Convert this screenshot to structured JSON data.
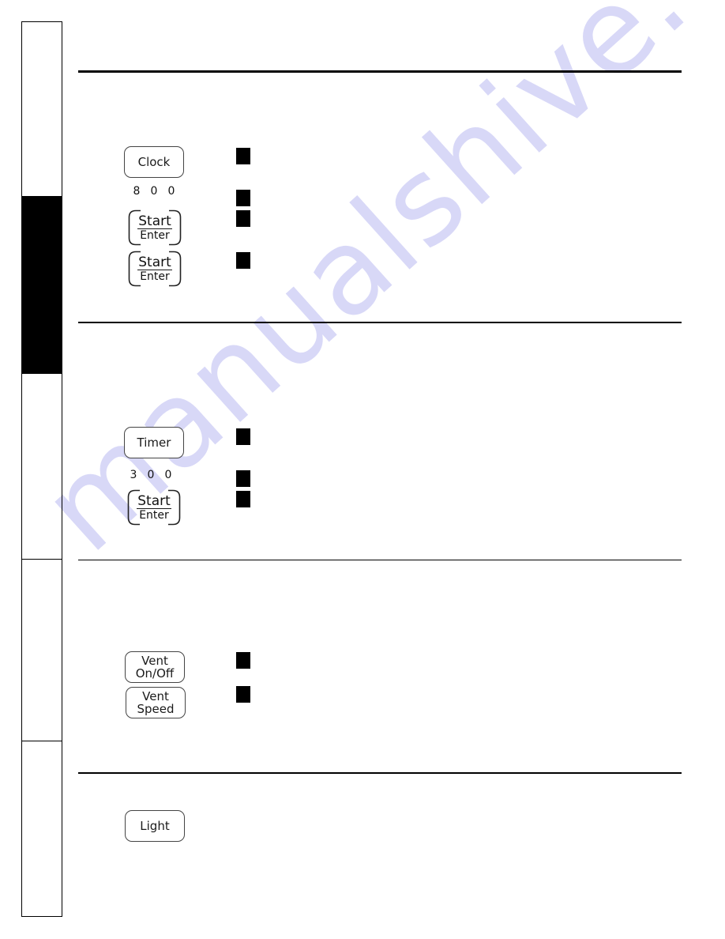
{
  "sidebar": {
    "tabs": [
      {
        "name": "tab-1",
        "active": false
      },
      {
        "name": "tab-2",
        "active": true
      },
      {
        "name": "tab-3",
        "active": false
      },
      {
        "name": "tab-4",
        "active": false
      },
      {
        "name": "tab-5",
        "active": false
      }
    ]
  },
  "sections": {
    "clock": {
      "button_label": "Clock",
      "digits": [
        "8",
        "0",
        "0"
      ],
      "start_label_top": "Start",
      "start_label_bottom": "Enter",
      "steps": 4
    },
    "timer": {
      "button_label": "Timer",
      "digits": [
        "3",
        "0",
        "0"
      ],
      "start_label_top": "Start",
      "start_label_bottom": "Enter",
      "steps": 3
    },
    "vent": {
      "onoff_line1": "Vent",
      "onoff_line2": "On/Off",
      "speed_line1": "Vent",
      "speed_line2": "Speed",
      "steps": 2
    },
    "light": {
      "button_label": "Light"
    }
  },
  "watermark": {
    "text": "manualshive.com",
    "color": "#d6d6f7"
  }
}
